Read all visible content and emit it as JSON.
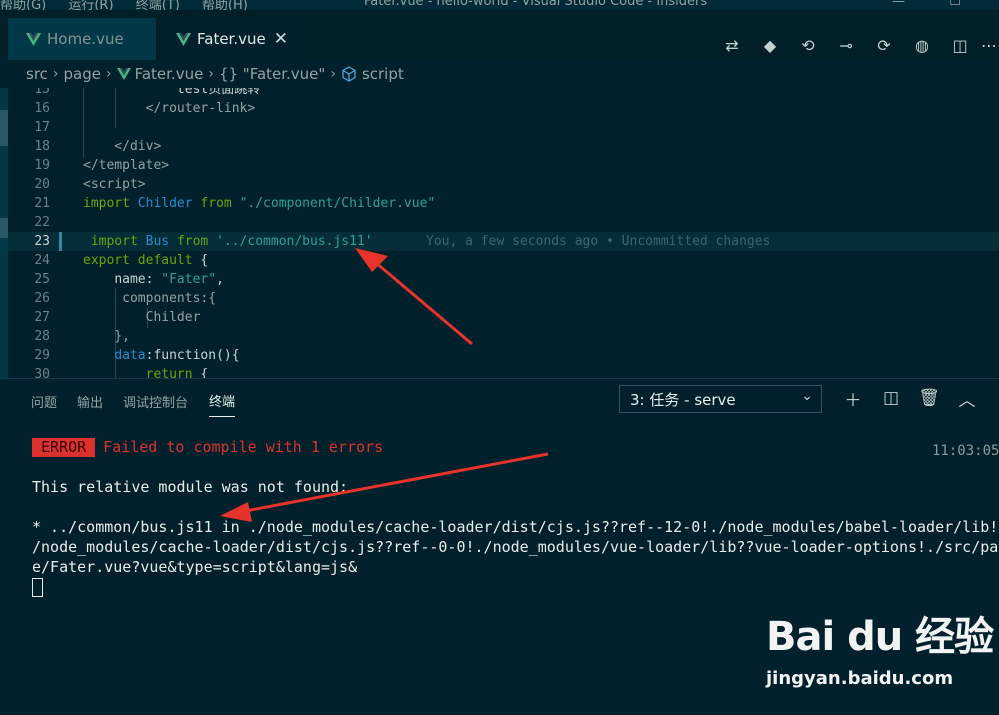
{
  "titlebar": {
    "menu": [
      "帮助(G)",
      "运行(R)",
      "终端(T)",
      "帮助(H)"
    ],
    "title": "Fater.vue - hello-world - Visual Studio Code - Insiders"
  },
  "tabs": [
    {
      "label": "Home.vue",
      "active": false,
      "icon": "vue-icon"
    },
    {
      "label": "Fater.vue",
      "active": true,
      "icon": "vue-icon"
    }
  ],
  "breadcrumb": [
    "src",
    "page",
    "Fater.vue",
    "{} \"Fater.vue\"",
    "script"
  ],
  "editor": {
    "lines": [
      {
        "n": "15",
        "code": "            test页面跳转"
      },
      {
        "n": "16",
        "code": "        </router-link>"
      },
      {
        "n": "17",
        "code": ""
      },
      {
        "n": "18",
        "code": "    </div>"
      },
      {
        "n": "19",
        "code": "</template>"
      },
      {
        "n": "20",
        "code": "<script>"
      },
      {
        "n": "21",
        "code": "import Childer from \"./component/Childer.vue\""
      },
      {
        "n": "22",
        "code": ""
      },
      {
        "n": "23",
        "code": " import Bus from '../common/bus.js11'"
      },
      {
        "n": "24",
        "code": "export default {"
      },
      {
        "n": "25",
        "code": "    name: \"Fater\","
      },
      {
        "n": "26",
        "code": "     components:{"
      },
      {
        "n": "27",
        "code": "        Childer"
      },
      {
        "n": "28",
        "code": "    },"
      },
      {
        "n": "29",
        "code": "    data:function(){"
      },
      {
        "n": "30",
        "code": "        return {"
      }
    ],
    "blame": "You, a few seconds ago • Uncommitted changes"
  },
  "panel": {
    "tabs": [
      "问题",
      "输出",
      "调试控制台",
      "终端"
    ],
    "active_tab": "终端",
    "select_value": "3: 任务 - serve"
  },
  "terminal": {
    "error_badge": "ERROR",
    "error_msg": "Failed to compile with 1 errors",
    "time": "11:03:05",
    "line1": "This relative module was not found:",
    "line2": "* ../common/bus.js11 in ./node_modules/cache-loader/dist/cjs.js??ref--12-0!./node_modules/babel-loader/lib!.",
    "line3": "/node_modules/cache-loader/dist/cjs.js??ref--0-0!./node_modules/vue-loader/lib??vue-loader-options!./src/pag",
    "line4": "e/Fater.vue?vue&type=script&lang=js&"
  },
  "watermark": {
    "brand": "Bai  du 经验",
    "url": "jingyan.baidu.com"
  },
  "colors": {
    "error": "#dc322f",
    "keyword": "#6ba40b",
    "string": "#2aa198",
    "tag": "#268bd2",
    "vue": "#41b883"
  }
}
